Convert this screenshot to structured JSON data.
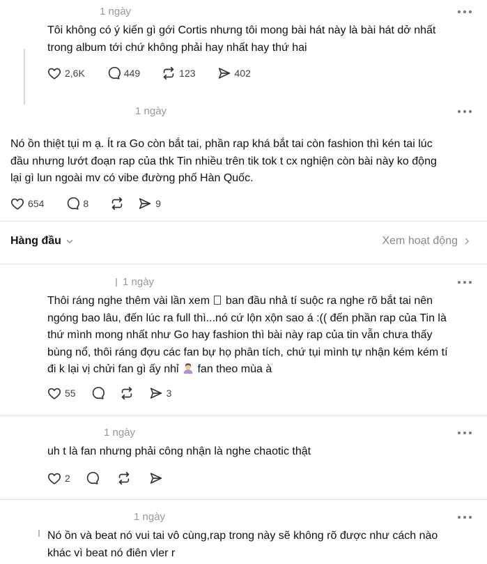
{
  "posts": [
    {
      "time": "1 ngày",
      "text_lines": [
        "Tôi không có ý kiến gì gới Cortis nhưng tôi mong bài hát này là bài hát dở nhất",
        "trong album tới chứ không phải hay nhất hay thứ hai"
      ],
      "likes": "2,6K",
      "comments": "449",
      "reposts": "123",
      "shares": "402"
    },
    {
      "time": "1 ngày",
      "text_lines": [
        "Nó ồn thiệt tụi m ạ. Ít ra Go còn bắt tai, phần rap khá bắt tai còn fashion thì kén tai lúc",
        "đầu nhưng lướt đoạn rap của thk Tin nhiều trên tik tok t cx nghiện còn bài này ko động",
        "lại gì lun ngoài mv có vibe đường phố Hàn Quốc."
      ],
      "likes": "654",
      "comments": "8",
      "shares": "9"
    }
  ],
  "sort": {
    "label": "Hàng đầu",
    "activity_link": "Xem hoạt động"
  },
  "replies": [
    {
      "time": "1 ngày",
      "line1_a": "Thôi ráng nghe thêm vài lần xem",
      "line1_b": "ban đầu nhả tí suộc ra nghe rõ bắt tai nên",
      "line2": "ngóng bao lâu, đến lúc ra full thì...nó cứ lộn xộn sao á :(( đến phần rap của Tin là",
      "line3": "thứ mình mong nhất như Go hay fashion thì bài này rap của tin vẫn chưa thấy",
      "line4": "bùng nổ, thôi ráng đợu các fan bự họ phân tích, chứ tụi mình tự nhận kém kém tí",
      "line5_a": "đi k lại vị chửi fan gì ấy nhỉ",
      "line5_b": "fan theo mùa à",
      "likes": "55",
      "shares": "3"
    },
    {
      "time": "1 ngày",
      "text_lines": [
        "uh t là fan nhưng phải công nhận là nghe chaotic thật"
      ],
      "likes": "2"
    },
    {
      "time": "1 ngày",
      "text_lines": [
        "Nó ồn và beat nó vui tai vô cùng,rap trong này sẽ không rõ được như cách nào",
        "khác vì beat nó điên vler r"
      ]
    }
  ],
  "icons": [
    "heart-icon",
    "comment-icon",
    "repost-icon",
    "share-icon",
    "more-icon",
    "chevron-down-icon",
    "chevron-right-icon"
  ]
}
